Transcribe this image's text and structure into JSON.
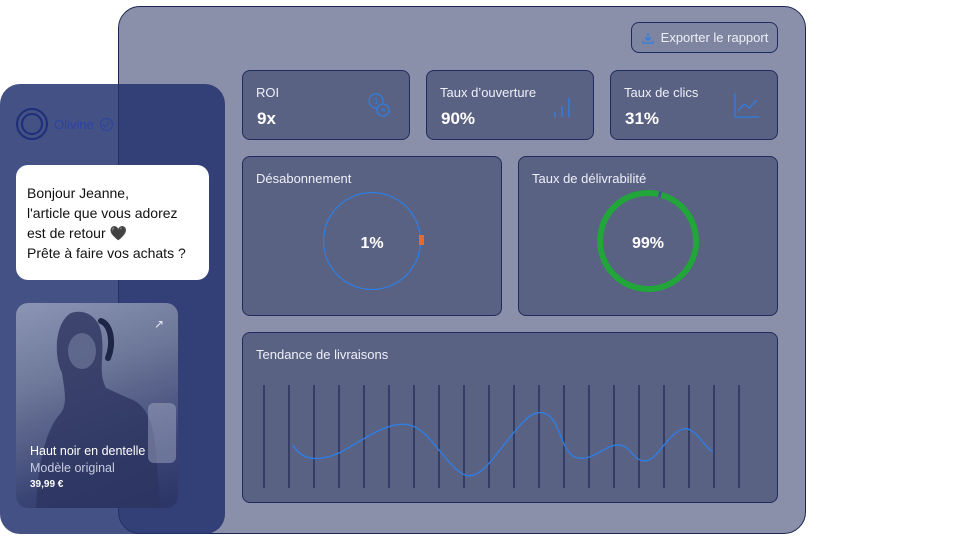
{
  "export_label": "Exporter le rapport",
  "metrics": {
    "roi": {
      "label": "ROI",
      "value": "9x",
      "icon": "coins-icon"
    },
    "open_rate": {
      "label": "Taux d’ouverture",
      "value": "90%",
      "icon": "bar-chart-icon"
    },
    "click_rate": {
      "label": "Taux de clics",
      "value": "31%",
      "icon": "line-chart-icon"
    }
  },
  "unsubscribe": {
    "label": "Désabonnement",
    "value": "1%",
    "fraction": 0.01
  },
  "deliverability": {
    "label": "Taux de délivrabilité",
    "value": "99%",
    "fraction": 0.99
  },
  "trend": {
    "label": "Tendance de livraisons"
  },
  "phone": {
    "brand": "Olivine",
    "message_lines": [
      "Bonjour Jeanne,",
      "l'article que vous adorez",
      "est de retour 🖤",
      "Prête à faire vos achats ?"
    ],
    "product": {
      "name": "Haut noir en dentelle",
      "subtitle": "Modèle original",
      "price": "39,99 €"
    }
  },
  "colors": {
    "accent_blue": "#2f7de1",
    "success_green": "#22a63a",
    "marker_orange": "#e8692a",
    "navy": "#1f2b5e"
  }
}
